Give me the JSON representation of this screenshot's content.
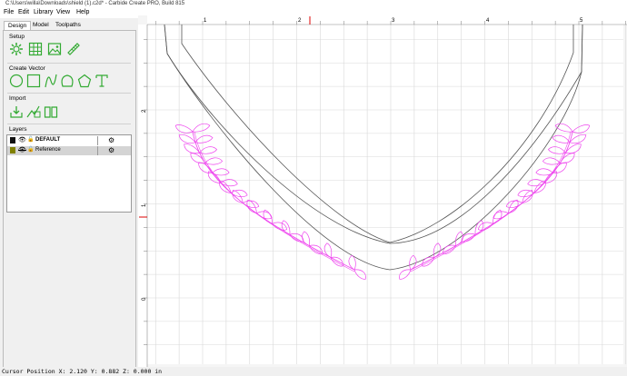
{
  "window": {
    "title": "C:\\Users\\willa\\Downloads\\shield (1).c2d* - Carbide Create PRO, Build 815"
  },
  "menu": [
    "File",
    "Edit",
    "Library",
    "View",
    "Help"
  ],
  "tabs": [
    {
      "label": "Design",
      "active": true
    },
    {
      "label": "Model",
      "active": false
    },
    {
      "label": "Toolpaths",
      "active": false
    }
  ],
  "sections": {
    "setup": "Setup",
    "create_vector": "Create Vector",
    "import": "Import",
    "layers": "Layers"
  },
  "setup_tools": [
    "gear-icon",
    "grid-icon",
    "image-icon",
    "ruler-icon"
  ],
  "vector_tools": [
    "circle-icon",
    "rectangle-icon",
    "curve-icon",
    "polygon-shape-icon",
    "pentagon-icon",
    "text-icon"
  ],
  "import_tools": [
    "import-icon",
    "import-svg-icon",
    "library-book-icon"
  ],
  "layers": [
    {
      "name": "DEFAULT",
      "color": "#111111",
      "visible": true,
      "locked": false,
      "bold": true
    },
    {
      "name": "Reference",
      "color": "#808000",
      "visible": false,
      "locked": false,
      "bold": false
    }
  ],
  "ruler": {
    "x_labels": [
      "1",
      "2",
      "3",
      "4",
      "5"
    ],
    "y_labels": [
      "2",
      "1",
      "0"
    ]
  },
  "status": {
    "text": "Cursor Position X: 2.120 Y: 0.882 Z: 0.000 in"
  },
  "colors": {
    "grid": "#d8d8d8",
    "vector": "#555555",
    "reference": "#ee44ee",
    "cursor_marker": "#dd0000"
  }
}
